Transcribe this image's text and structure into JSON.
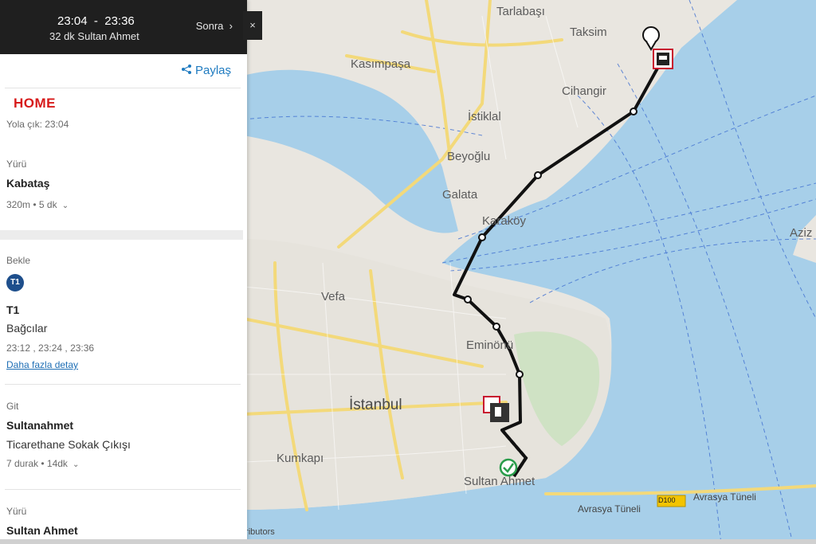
{
  "header": {
    "depart_time": "23:04",
    "separator": "-",
    "arrive_time": "23:36",
    "summary": "32 dk  Sultan Ahmet",
    "later_label": "Sonra",
    "later_icon": "chevron-right-icon",
    "close_label": "×"
  },
  "share": {
    "label": "Paylaş",
    "icon": "share-icon",
    "color": "#1f7bc0"
  },
  "start": {
    "label": "HOME",
    "depart": "Yola çık: 23:04",
    "color": "#d71a1a"
  },
  "walk1": {
    "type": "Yürü",
    "destination": "Kabataş",
    "details": "320m  •  5 dk"
  },
  "wait": {
    "type": "Bekle",
    "line_badge": "T1",
    "line_name": "T1",
    "direction": "Bağcılar",
    "departures": "23:12 , 23:24 , 23:36",
    "more_link": "Daha fazla detay"
  },
  "ride": {
    "type": "Git",
    "stop": "Sultanahmet",
    "exit": "Ticarethane Sokak Çıkışı",
    "details": "7 durak  •  14dk"
  },
  "walk2": {
    "type": "Yürü",
    "destination": "Sultan Ahmet"
  },
  "map": {
    "labels": {
      "tarlabasi": "Tarlabaşı",
      "taksim": "Taksim",
      "kasimpasa": "Kasımpaşa",
      "cihangir": "Cihangir",
      "istiklal": "İstiklal",
      "beyoglu": "Beyoğlu",
      "galata": "Galata",
      "karakoy": "Karaköy",
      "vefa": "Vefa",
      "eminonu": "Eminönü",
      "istanbul": "İstanbul",
      "kumkapi": "Kumkapı",
      "sultanahmet": "Sultan Ahmet",
      "aziz": "Aziz",
      "avrasya1": "Avrasya Tüneli",
      "avrasya2": "Avrasya Tüneli",
      "d100": "D100",
      "attribution": "tributors"
    },
    "colors": {
      "water": "#a7cfe9",
      "land": "#e9e6e0",
      "road": "#f3d97a",
      "route": "#111111"
    }
  }
}
